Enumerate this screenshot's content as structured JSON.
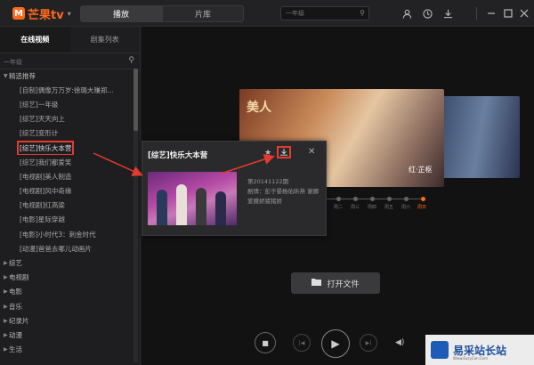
{
  "app": {
    "logo_text": "芒果tv",
    "logo_mark": "M",
    "logo_caret": "▾"
  },
  "header": {
    "tabs": [
      {
        "label": "播放",
        "active": true
      },
      {
        "label": "片库",
        "active": false
      }
    ],
    "search_placeholder": "一年级",
    "icons": [
      "user-icon",
      "history-icon",
      "download-icon",
      "minimize-icon",
      "maximize-icon",
      "close-icon"
    ]
  },
  "sidebar": {
    "tabs": [
      {
        "label": "在线视频",
        "active": true
      },
      {
        "label": "剧集列表",
        "active": false
      }
    ],
    "search_placeholder": "一年级",
    "tree": [
      {
        "label": "精选推荐",
        "expanded": true,
        "children": [
          "[自制]偶像万万岁:徐璐大赚郑...",
          "[综艺]一年级",
          "[综艺]天天向上",
          "[综艺]变形计",
          "[综艺]快乐大本营",
          "[综艺]我们都爱笑",
          "[电视剧]美人制造",
          "[电视剧]风中奇缘",
          "[电视剧]红高粱",
          "[电影]星际穿越",
          "[电影]小时代3：刺金时代",
          "[动漫]爸爸去哪儿动画片"
        ]
      },
      {
        "label": "综艺"
      },
      {
        "label": "电视剧"
      },
      {
        "label": "电影"
      },
      {
        "label": "音乐"
      },
      {
        "label": "纪录片"
      },
      {
        "label": "动漫"
      },
      {
        "label": "生活"
      }
    ],
    "selected_index": 4
  },
  "poster": {
    "overlay_text": "美人",
    "caption": "红·芷枢"
  },
  "timeline": {
    "labels": [
      "周一",
      "周二",
      "周三",
      "周四",
      "周五",
      "周六",
      "周日"
    ],
    "active_label": "周日"
  },
  "popup": {
    "title": "[综艺]快乐大本营",
    "episode": "第20141122期",
    "desc": "剧情：彭于晏杨佑昕燕 谢娜爱撒娇猪猪娇",
    "star_icon": "star-icon",
    "download_icon": "download-icon",
    "close_icon": "close-icon"
  },
  "main": {
    "open_file_label": "打开文件"
  },
  "controls": {
    "stop_icon": "■",
    "prev_icon": "|◀",
    "play_icon": "▶",
    "next_icon": "▶|",
    "volume_icon": "◀)"
  },
  "watermark": {
    "title": "易采站长站",
    "subtitle": "Www.EasyCon.Com"
  },
  "colors": {
    "accent": "#ff6a1a",
    "highlight": "#e53b2e"
  }
}
